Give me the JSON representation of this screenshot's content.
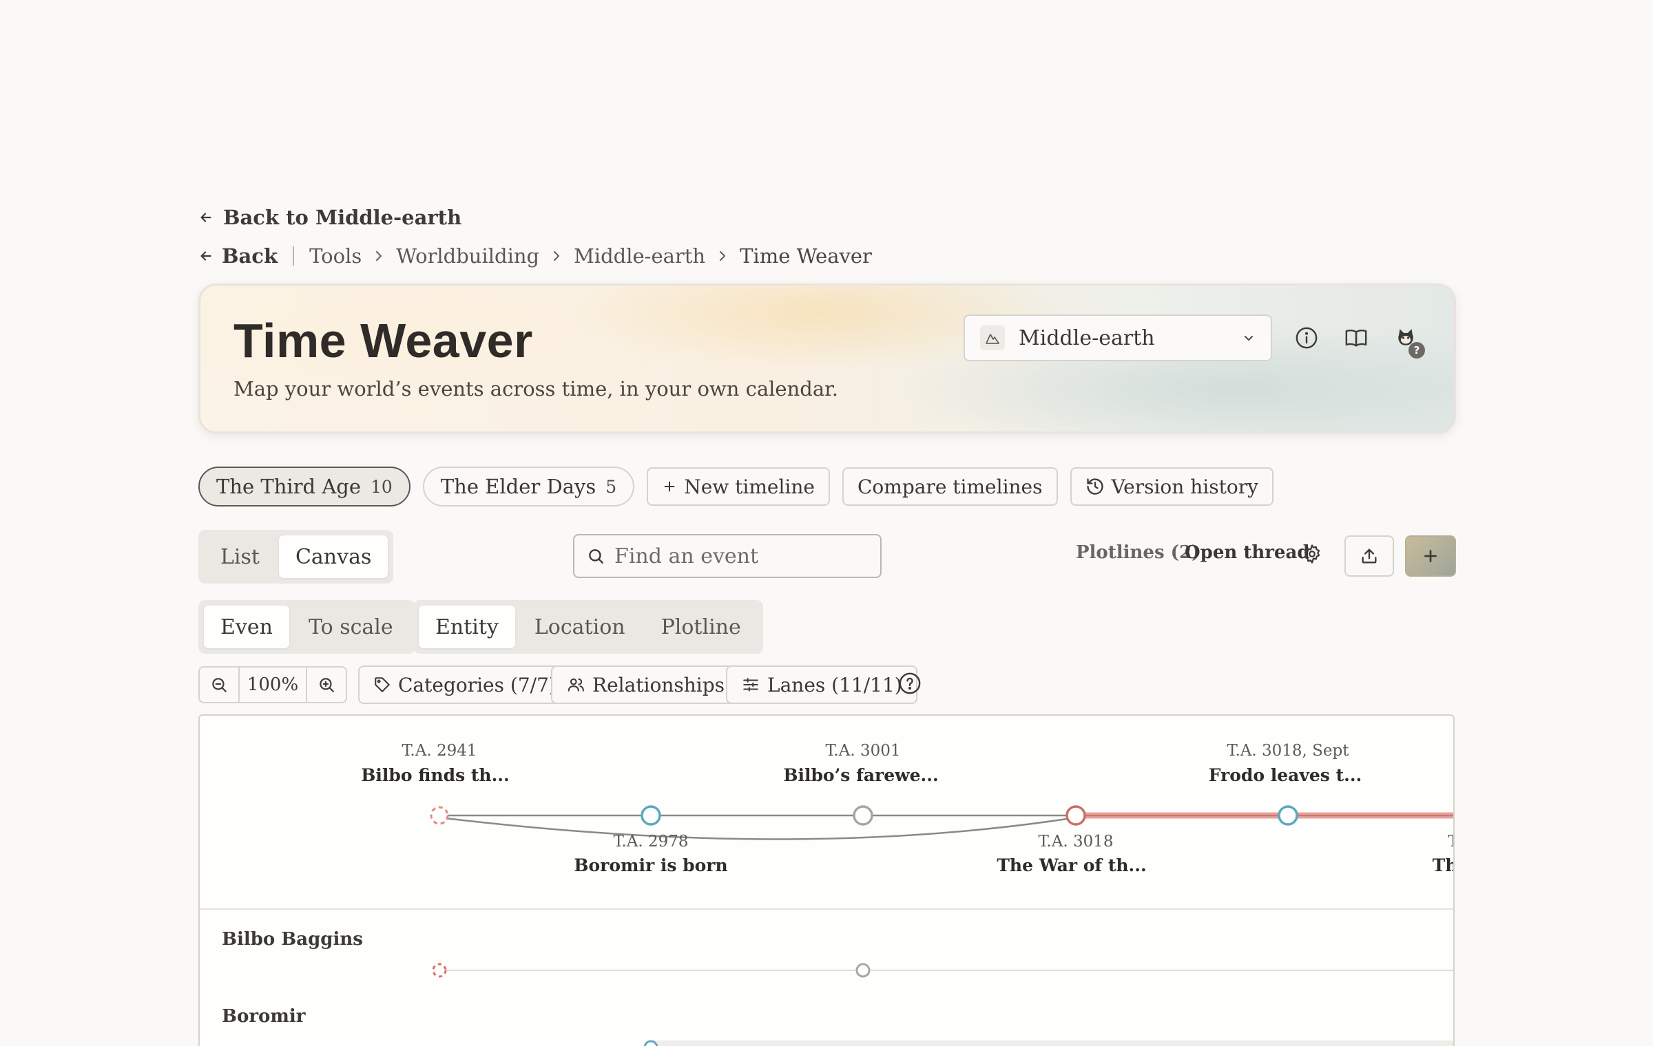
{
  "nav": {
    "back_link": "Back to Middle-earth",
    "breadcrumb": {
      "back": "Back",
      "items": [
        "Tools",
        "Worldbuilding",
        "Middle-earth",
        "Time Weaver"
      ]
    }
  },
  "hero": {
    "title": "Time Weaver",
    "subtitle": "Map your world’s events across time, in your own calendar.",
    "world_select": "Middle-earth",
    "avatar_badge": "?"
  },
  "timelines": {
    "tabs": [
      {
        "label": "The Third Age",
        "count": "10",
        "active": true
      },
      {
        "label": "The Elder Days",
        "count": "5",
        "active": false
      }
    ],
    "new_timeline": "New timeline",
    "compare": "Compare timelines",
    "version_history": "Version history"
  },
  "view": {
    "modes": [
      "List",
      "Canvas"
    ],
    "active_mode": "Canvas",
    "search_placeholder": "Find an event",
    "plotlines": "Plotlines (2)",
    "open_thread": "Open thread",
    "add": "+"
  },
  "spacing": {
    "options": [
      "Even",
      "To scale"
    ],
    "active": "Even"
  },
  "grouping": {
    "options": [
      "Entity",
      "Location",
      "Plotline"
    ],
    "active": "Entity"
  },
  "toolbar": {
    "zoom": "100%",
    "categories": "Categories (7/7)",
    "relationships": "Relationships",
    "lanes": "Lanes (11/11)"
  },
  "canvas": {
    "events_top": [
      {
        "date": "T.A. 2941",
        "title": "Bilbo finds th..."
      },
      {
        "date": "T.A. 3001",
        "title": "Bilbo’s farewe..."
      },
      {
        "date": "T.A. 3018, Sept",
        "title": "Frodo leaves t..."
      }
    ],
    "events_bottom": [
      {
        "date": "T.A. 2978",
        "title": "Boromir is born"
      },
      {
        "date": "T.A. 3018",
        "title": "The War of th..."
      },
      {
        "date": "T",
        "title": "Th"
      }
    ],
    "lanes": [
      "Bilbo Baggins",
      "Boromir"
    ]
  },
  "colors": {
    "accent_red": "#d98a85",
    "accent_teal": "#5aa9bd",
    "neutral_node": "#a9a6a2",
    "line": "#8c8985"
  }
}
